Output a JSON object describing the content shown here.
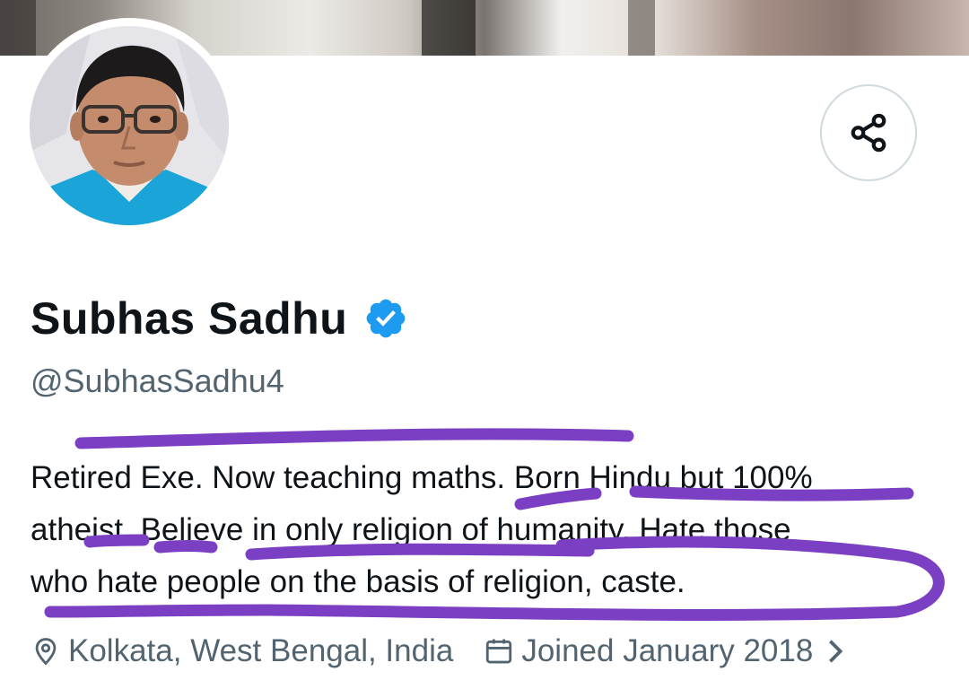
{
  "profile": {
    "display_name": "Subhas Sadhu",
    "handle": "@SubhasSadhu4",
    "verified": true,
    "bio_lines": [
      "Retired Exe. Now teaching maths. Born Hindu but 100%",
      "atheist. Believe in only religion of humanity. Hate those",
      "who hate people on the basis of religion, caste."
    ],
    "location": "Kolkata, West Bengal, India",
    "joined": "Joined January 2018"
  },
  "icons": {
    "share": "share-icon",
    "verified": "verified-badge-icon",
    "location": "location-pin-icon",
    "calendar": "calendar-icon",
    "chevron": "chevron-right-icon"
  },
  "colors": {
    "text_primary": "#0f1419",
    "text_secondary": "#536471",
    "verified_blue": "#1d9bf0",
    "button_border": "#cfd9de",
    "annotation_purple": "#7b3fc4"
  }
}
